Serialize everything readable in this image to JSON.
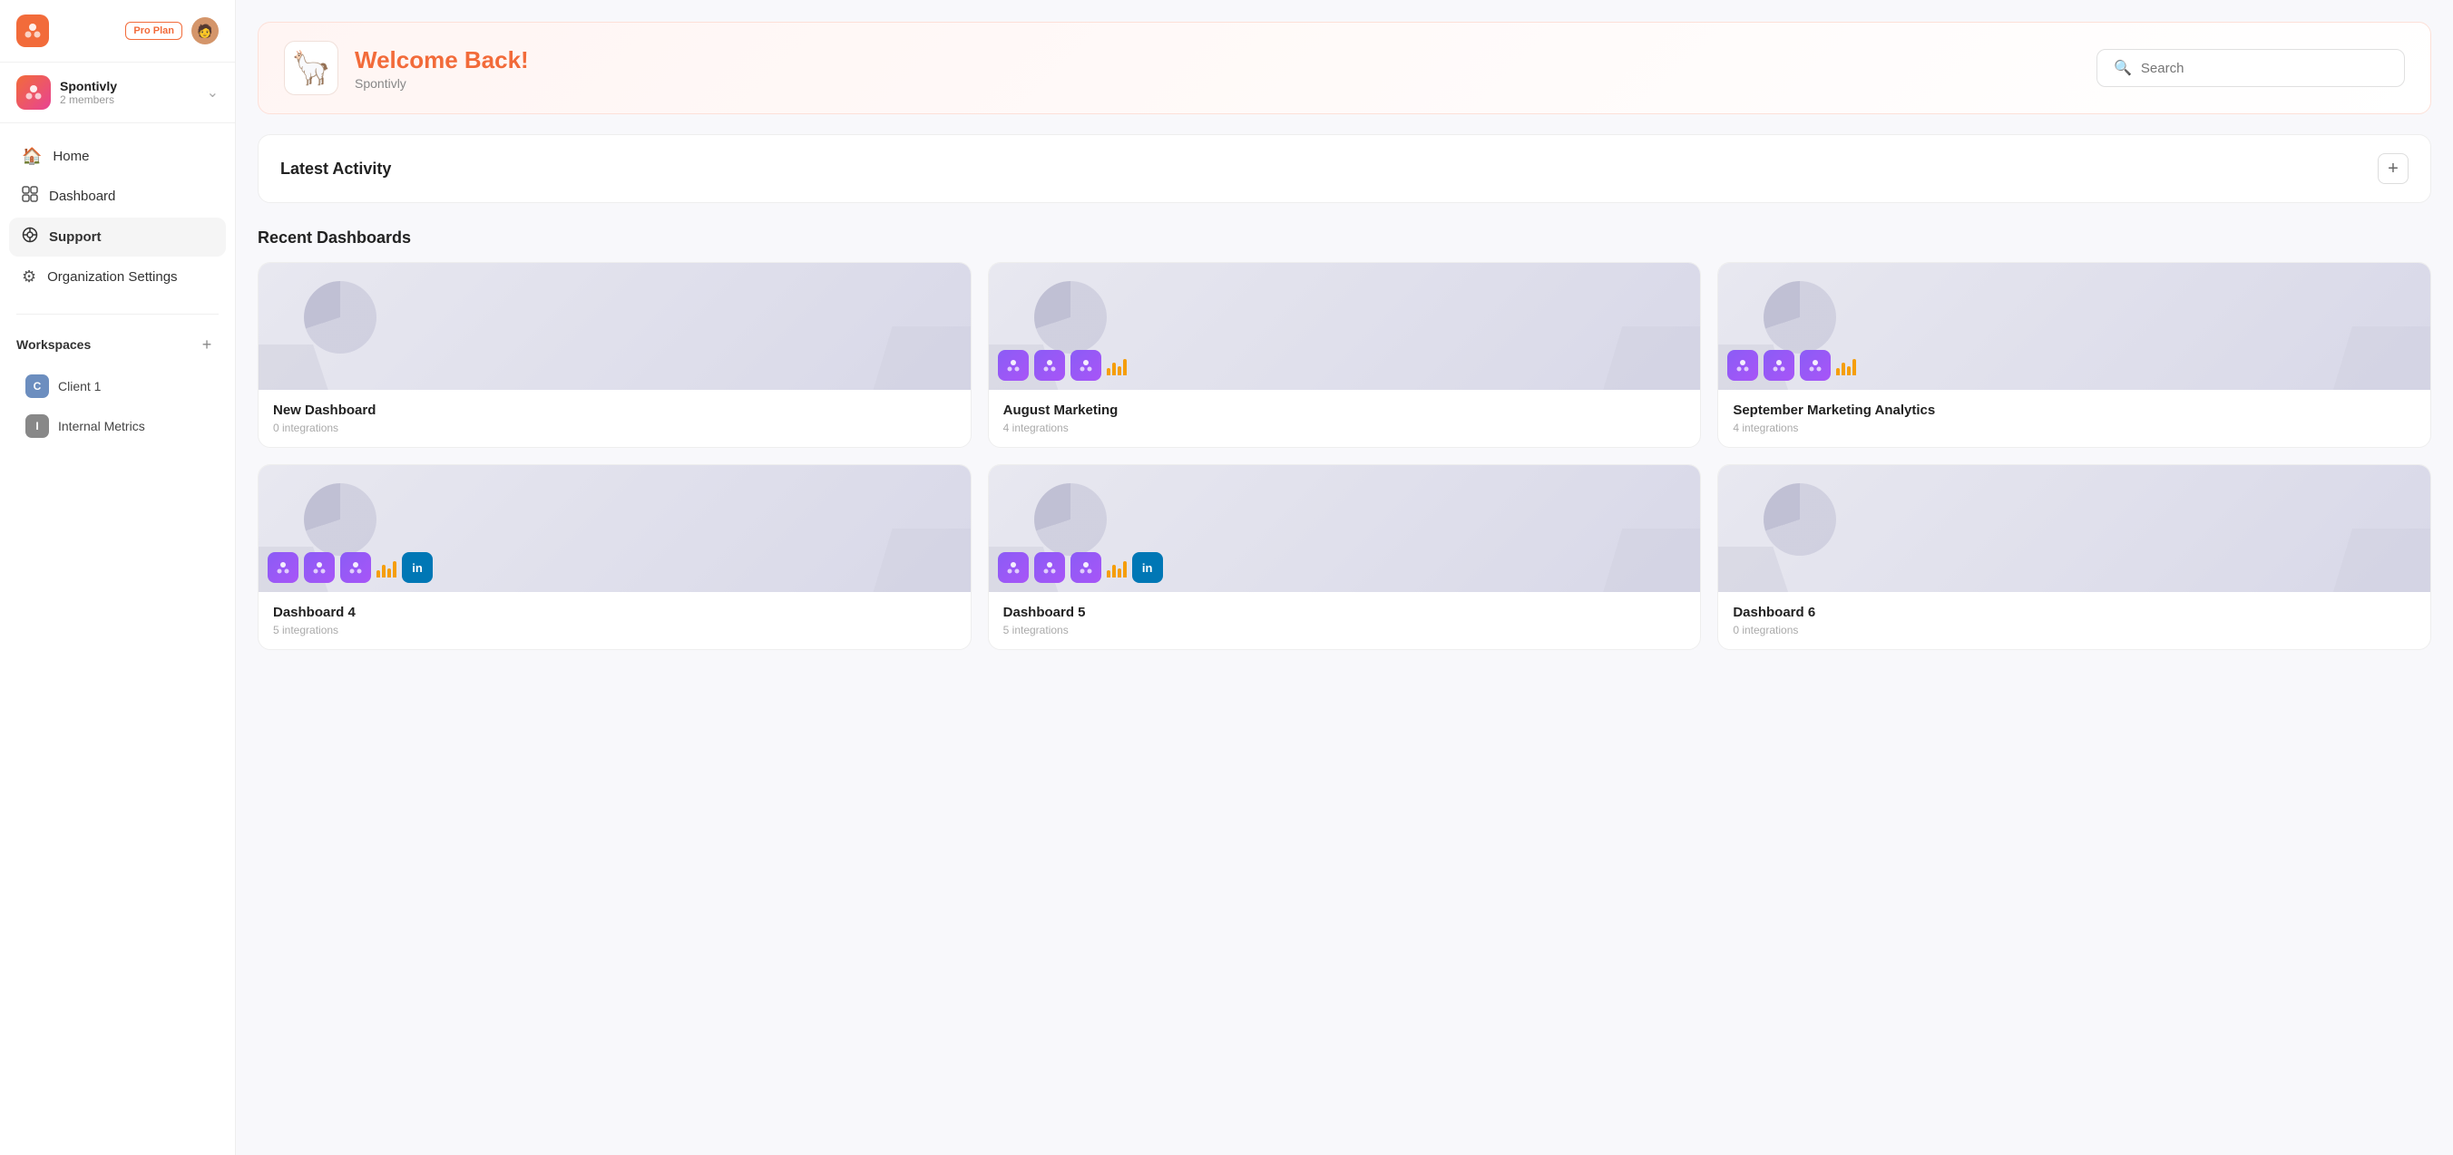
{
  "app": {
    "logo_label": "App Logo",
    "pro_plan": "Pro Plan"
  },
  "org": {
    "name": "Spontivly",
    "members": "2 members"
  },
  "nav": {
    "items": [
      {
        "id": "home",
        "label": "Home",
        "icon": "🏠"
      },
      {
        "id": "dashboard",
        "label": "Dashboard",
        "icon": "⊞"
      },
      {
        "id": "support",
        "label": "Support",
        "icon": "⊙",
        "active": true
      },
      {
        "id": "org-settings",
        "label": "Organization Settings",
        "icon": "⚙"
      }
    ]
  },
  "workspaces": {
    "title": "Workspaces",
    "add_label": "+",
    "items": [
      {
        "id": "client1",
        "label": "Client 1",
        "badge": "C",
        "badge_class": "badge-c"
      },
      {
        "id": "internal",
        "label": "Internal Metrics",
        "badge": "I",
        "badge_class": "badge-i"
      }
    ]
  },
  "welcome": {
    "title": "Welcome Back!",
    "subtitle": "Spontivly",
    "emoji": "🦙"
  },
  "search": {
    "placeholder": "Search"
  },
  "activity": {
    "title": "Latest Activity",
    "add_label": "+"
  },
  "recent_dashboards": {
    "title": "Recent Dashboards",
    "items": [
      {
        "id": "new-dashboard",
        "title": "New Dashboard",
        "meta": "0 integrations",
        "has_integrations": false
      },
      {
        "id": "august-marketing",
        "title": "August Marketing",
        "meta": "4 integrations",
        "has_integrations": true
      },
      {
        "id": "september-marketing",
        "title": "September Marketing Analytics",
        "meta": "4 integrations",
        "has_integrations": true
      },
      {
        "id": "dashboard-4",
        "title": "Dashboard 4",
        "meta": "5 integrations",
        "has_integrations": true,
        "has_linkedin": true
      },
      {
        "id": "dashboard-5",
        "title": "Dashboard 5",
        "meta": "5 integrations",
        "has_integrations": true,
        "has_linkedin": true
      },
      {
        "id": "dashboard-6",
        "title": "Dashboard 6",
        "meta": "0 integrations",
        "has_integrations": false
      }
    ]
  }
}
